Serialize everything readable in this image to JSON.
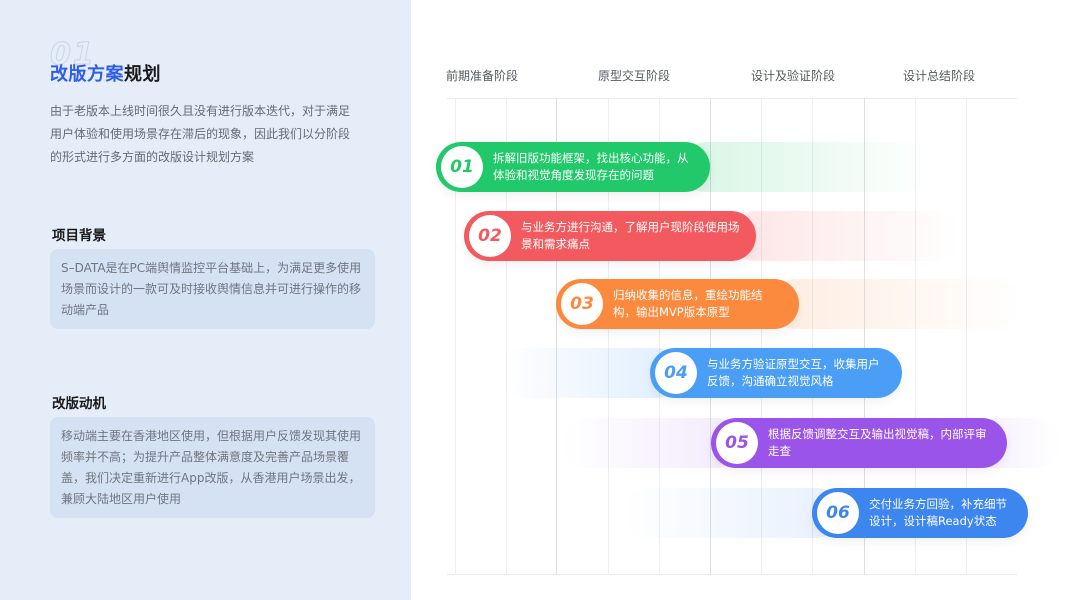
{
  "left": {
    "ghost_number": "01",
    "title_highlight": "改版方案",
    "title_rest": "规划",
    "intro": "由于老版本上线时间很久且没有进行版本迭代，对于满足用户体验和使用场景存在滞后的现象，因此我们以分阶段的形式进行多方面的改版设计规划方案",
    "background": {
      "heading": "项目背景",
      "body": "S–DATA是在PC端舆情监控平台基础上，为满足更多使用场景而设计的一款可及时接收舆情信息并可进行操作的移动端产品"
    },
    "motivation": {
      "heading": "改版动机",
      "body": "移动端主要在香港地区使用，但根据用户反馈发现其使用频率并不高；为提升产品整体满意度及完善产品场景覆盖，我们决定重新进行App改版，从香港用户场景出发，兼顾大陆地区用户使用"
    }
  },
  "phases": [
    "前期准备阶段",
    "原型交互阶段",
    "设计及验证阶段",
    "设计总结阶段"
  ],
  "steps": [
    {
      "num": "01",
      "text": "拆解旧版功能框架，找出核心功能，从体验和视觉角度发现存在的问题",
      "color": "#21c96a"
    },
    {
      "num": "02",
      "text": "与业务方进行沟通，了解用户现阶段使用场景和需求痛点",
      "color": "#f25a5f"
    },
    {
      "num": "03",
      "text": "归纳收集的信息，重绘功能结构，输出MVP版本原型",
      "color": "#fb8a3e"
    },
    {
      "num": "04",
      "text": "与业务方验证原型交互，收集用户反馈，沟通确立视觉风格",
      "color": "#4a9ef5"
    },
    {
      "num": "05",
      "text": "根据反馈调整交互及输出视觉稿，内部评审走查",
      "color": "#9b54ea"
    },
    {
      "num": "06",
      "text": "交付业务方回验，补充细节设计，设计稿Ready状态",
      "color": "#3d86f0"
    }
  ]
}
